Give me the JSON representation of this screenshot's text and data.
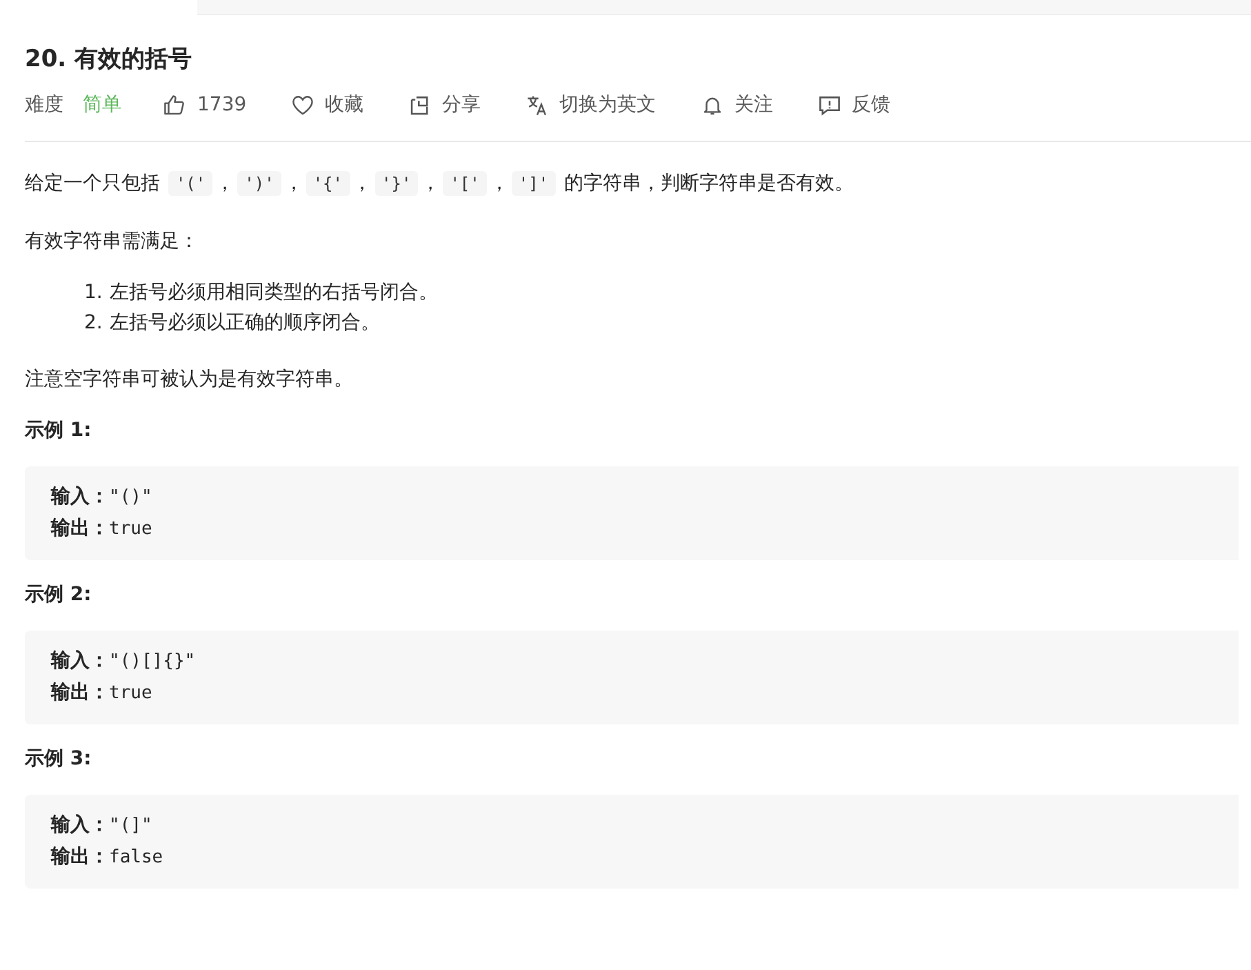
{
  "title": "20. 有效的括号",
  "difficulty": {
    "label": "难度",
    "value": "简单"
  },
  "actions": [
    {
      "kind": "like",
      "label": "1739"
    },
    {
      "kind": "favorite",
      "label": "收藏"
    },
    {
      "kind": "share",
      "label": "分享"
    },
    {
      "kind": "translate",
      "label": "切换为英文"
    },
    {
      "kind": "follow",
      "label": "关注"
    },
    {
      "kind": "feedback",
      "label": "反馈"
    }
  ],
  "description": [
    {
      "kind": "text",
      "parts": [
        {
          "kind": "plain",
          "text": "给定一个只包括 "
        },
        {
          "kind": "code",
          "text": "'('"
        },
        {
          "kind": "plain",
          "text": "，"
        },
        {
          "kind": "code",
          "text": "')'"
        },
        {
          "kind": "plain",
          "text": "，"
        },
        {
          "kind": "code",
          "text": "'{'"
        },
        {
          "kind": "plain",
          "text": "，"
        },
        {
          "kind": "code",
          "text": "'}'"
        },
        {
          "kind": "plain",
          "text": "，"
        },
        {
          "kind": "code",
          "text": "'['"
        },
        {
          "kind": "plain",
          "text": "，"
        },
        {
          "kind": "code",
          "text": "']'"
        },
        {
          "kind": "plain",
          "text": " 的字符串，判断字符串是否有效。"
        }
      ]
    },
    {
      "kind": "text",
      "parts": [
        {
          "kind": "plain",
          "text": "有效字符串需满足："
        }
      ]
    },
    {
      "kind": "list",
      "items": [
        "左括号必须用相同类型的右括号闭合。",
        "左括号必须以正确的顺序闭合。"
      ],
      "markers": [
        "1.",
        "2."
      ]
    },
    {
      "kind": "text",
      "parts": [
        {
          "kind": "plain",
          "text": "注意空字符串可被认为是有效字符串。"
        }
      ]
    }
  ],
  "examples": [
    {
      "heading": "示例 1:",
      "lines": [
        {
          "label": "输入：",
          "value": "\"()\""
        },
        {
          "label": "输出：",
          "value": "true"
        }
      ]
    },
    {
      "heading": "示例 2:",
      "lines": [
        {
          "label": "输入：",
          "value": "\"()[]{}\""
        },
        {
          "label": "输出：",
          "value": "true"
        }
      ]
    },
    {
      "heading": "示例 3:",
      "lines": [
        {
          "label": "输入：",
          "value": "\"(]\""
        },
        {
          "label": "输出：",
          "value": "false"
        }
      ]
    }
  ]
}
